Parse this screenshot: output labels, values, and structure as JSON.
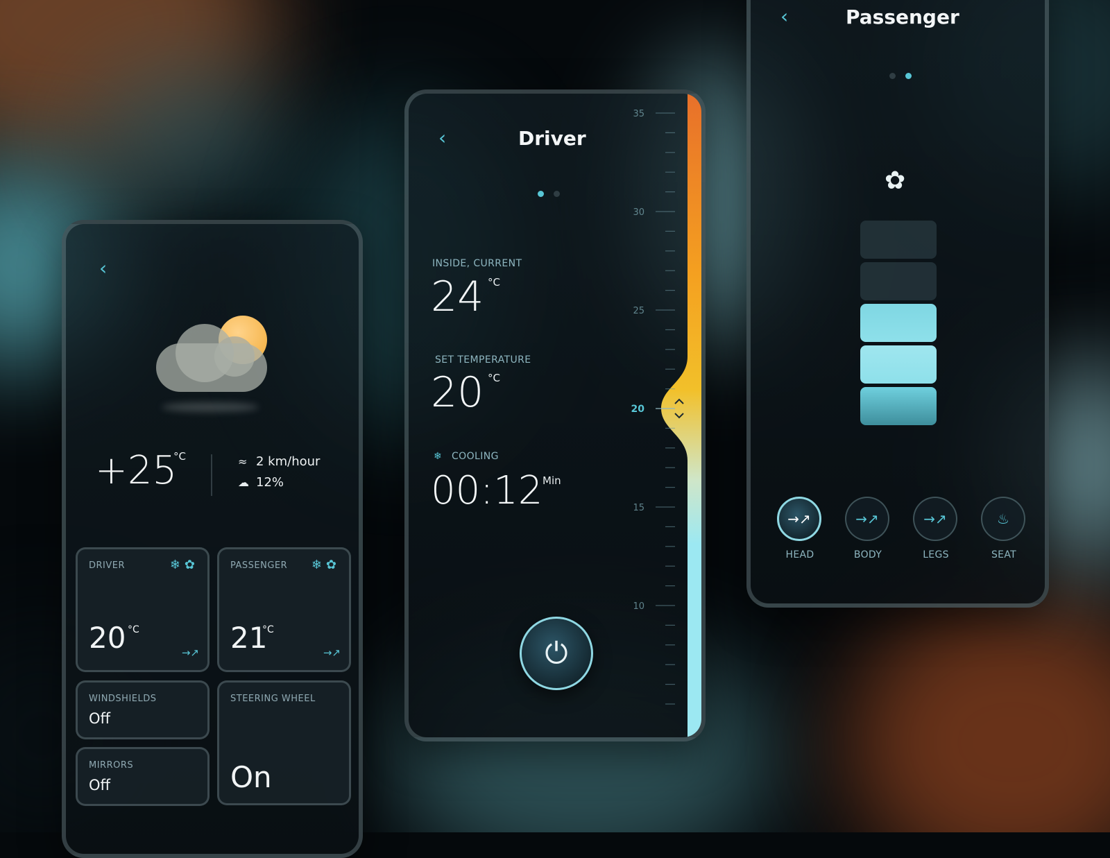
{
  "colors": {
    "accent": "#58c6d6",
    "warm": "#f08a24",
    "sun": "#f2ac3a",
    "cool": "#9ce8f2"
  },
  "weather_panel": {
    "back_icon": "chevron-left-icon",
    "weather_icon": "partly-cloudy-icon",
    "temperature": "+25",
    "temperature_unit": "°C",
    "wind": "2 km/hour",
    "precipitation": "12%",
    "tiles": {
      "driver": {
        "label": "DRIVER",
        "temp": "20",
        "unit": "°C"
      },
      "passenger": {
        "label": "PASSENGER",
        "temp": "21",
        "unit": "°C"
      },
      "windshields": {
        "label": "WINDSHIELDS",
        "value": "Off"
      },
      "steering": {
        "label": "STEERING WHEEL",
        "value": "On"
      },
      "mirrors": {
        "label": "MIRRORS",
        "value": "Off"
      }
    }
  },
  "driver_panel": {
    "title": "Driver",
    "page_indicator": {
      "count": 2,
      "active": 1
    },
    "inside_label": "INSIDE, CURRENT",
    "inside_value": "24",
    "inside_unit": "°C",
    "set_label": "SET TEMPERATURE",
    "set_value": "20",
    "set_unit": "°C",
    "cooling_label": "COOLING",
    "timer": "00:12",
    "timer_unit": "Min",
    "power_icon": "power-icon",
    "scale": {
      "min": 5,
      "max": 35,
      "labels": [
        "35",
        "30",
        "25",
        "20",
        "15",
        "10"
      ],
      "selected": 20
    }
  },
  "passenger_panel": {
    "title": "Passenger",
    "page_indicator": {
      "count": 2,
      "active": 2
    },
    "fan_icon": "fan-icon",
    "fan_level": 3,
    "fan_levels": 5,
    "modes": [
      {
        "label": "HEAD",
        "active": true
      },
      {
        "label": "BODY",
        "active": false
      },
      {
        "label": "LEGS",
        "active": false
      },
      {
        "label": "SEAT",
        "active": false
      }
    ]
  }
}
